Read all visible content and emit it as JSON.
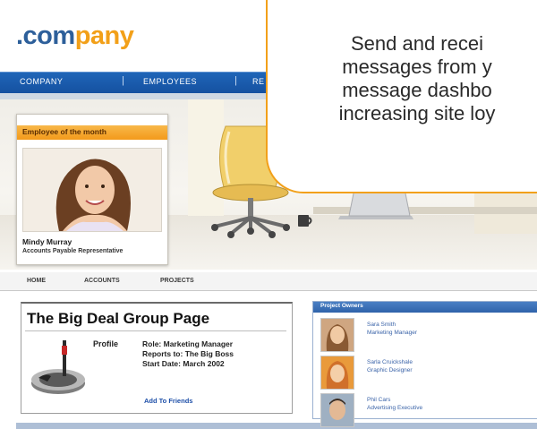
{
  "logo": {
    "part1": ".com",
    "part2": "pany"
  },
  "top_nav": {
    "items": [
      "COMPANY",
      "EMPLOYEES",
      "RE"
    ],
    "separator": "|"
  },
  "employee_of_month": {
    "title": "Employee of the month",
    "name": "Mindy Murray",
    "role": "Accounts Payable Representative"
  },
  "sub_nav": {
    "items": [
      "HOME",
      "ACCOUNTS",
      "PROJECTS"
    ]
  },
  "group_page": {
    "title": "The Big Deal Group Page",
    "profile_label": "Profile",
    "role": "Role: Marketing Manager",
    "reports_to": "Reports to: The Big Boss",
    "start_date": "Start Date: March 2002",
    "add_friends": "Add To Friends"
  },
  "project_owners": {
    "title": "Project Owners",
    "items": [
      {
        "name": "Sara Smith",
        "role": "Marketing Manager"
      },
      {
        "name": "Sarla Cruickshale",
        "role": "Graphic Designer"
      },
      {
        "name": "Phil Cars",
        "role": "Advertising Executive"
      }
    ]
  },
  "callout": {
    "lines": [
      "Send and recei",
      "messages from y",
      "message dashbo",
      "increasing site loy"
    ]
  },
  "colors": {
    "brand_blue": "#2d5f9a",
    "brand_orange": "#f2a019",
    "nav_blue": "#1f65b8",
    "link_blue": "#1d4fa8"
  }
}
